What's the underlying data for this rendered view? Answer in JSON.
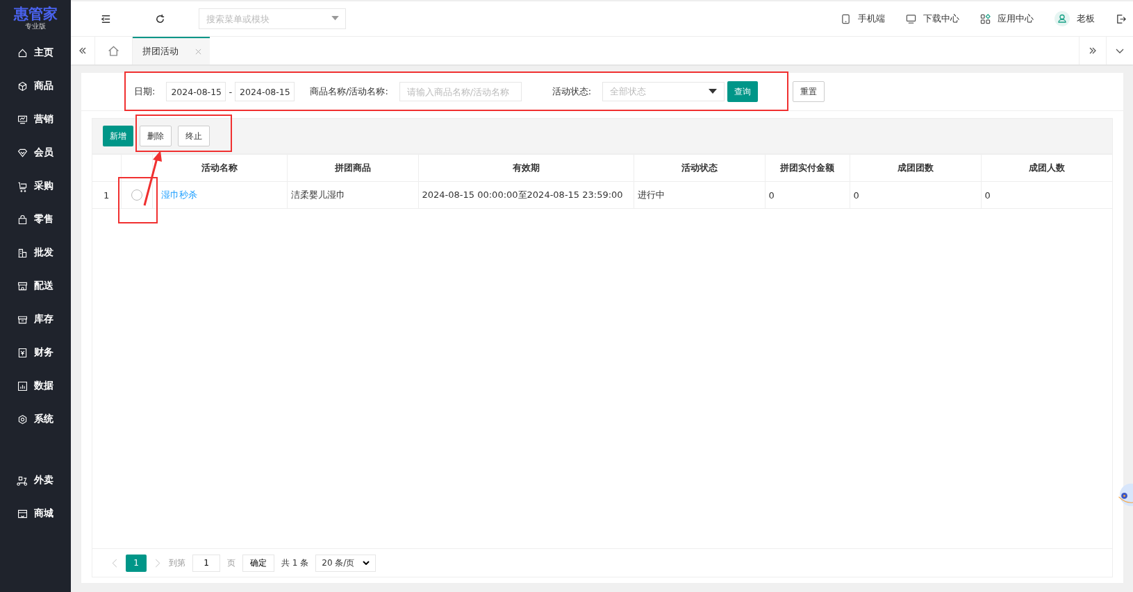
{
  "brand": {
    "name": "惠管家",
    "edition": "专业版"
  },
  "sidebar": {
    "items": [
      {
        "label": "主页"
      },
      {
        "label": "商品"
      },
      {
        "label": "营销"
      },
      {
        "label": "会员"
      },
      {
        "label": "采购"
      },
      {
        "label": "零售"
      },
      {
        "label": "批发"
      },
      {
        "label": "配送"
      },
      {
        "label": "库存"
      },
      {
        "label": "财务"
      },
      {
        "label": "数据"
      },
      {
        "label": "系统"
      }
    ],
    "extra_items": [
      {
        "label": "外卖"
      },
      {
        "label": "商城"
      }
    ]
  },
  "topbar": {
    "search": {
      "placeholder": "搜索菜单或模块"
    },
    "links": [
      "手机端",
      "下载中心",
      "应用中心"
    ],
    "user": "老板"
  },
  "tabs": [
    {
      "label": "拼团活动",
      "selected": true
    }
  ],
  "filter": {
    "date_label": "日期:",
    "start_date": "2024-08-15",
    "separator": "-",
    "end_date": "2024-08-15",
    "name_label": "商品名称/活动名称:",
    "name_placeholder": "请输入商品名称/活动名称",
    "status_label": "活动状态:",
    "status_placeholder": "全部状态",
    "query": "查询",
    "reset": "重置"
  },
  "toolbar": {
    "add": "新增",
    "delete": "删除",
    "stop": "终止"
  },
  "table": {
    "columns": [
      "活动名称",
      "拼团商品",
      "有效期",
      "活动状态",
      "拼团实付金额",
      "成团团数",
      "成团人数"
    ],
    "rows": [
      {
        "index": "1",
        "selected": false,
        "cells": [
          "湿巾秒杀",
          "洁柔婴儿湿巾",
          "2024-08-15 00:00:00至2024-08-15 23:59:00",
          "进行中",
          "0",
          "0",
          "0"
        ]
      }
    ]
  },
  "pagination": {
    "page": "1",
    "goto_label": "到第",
    "goto_value": "1",
    "page_unit": "页",
    "confirm": "确定",
    "total": "共 1 条",
    "page_size": "20 条/页"
  }
}
